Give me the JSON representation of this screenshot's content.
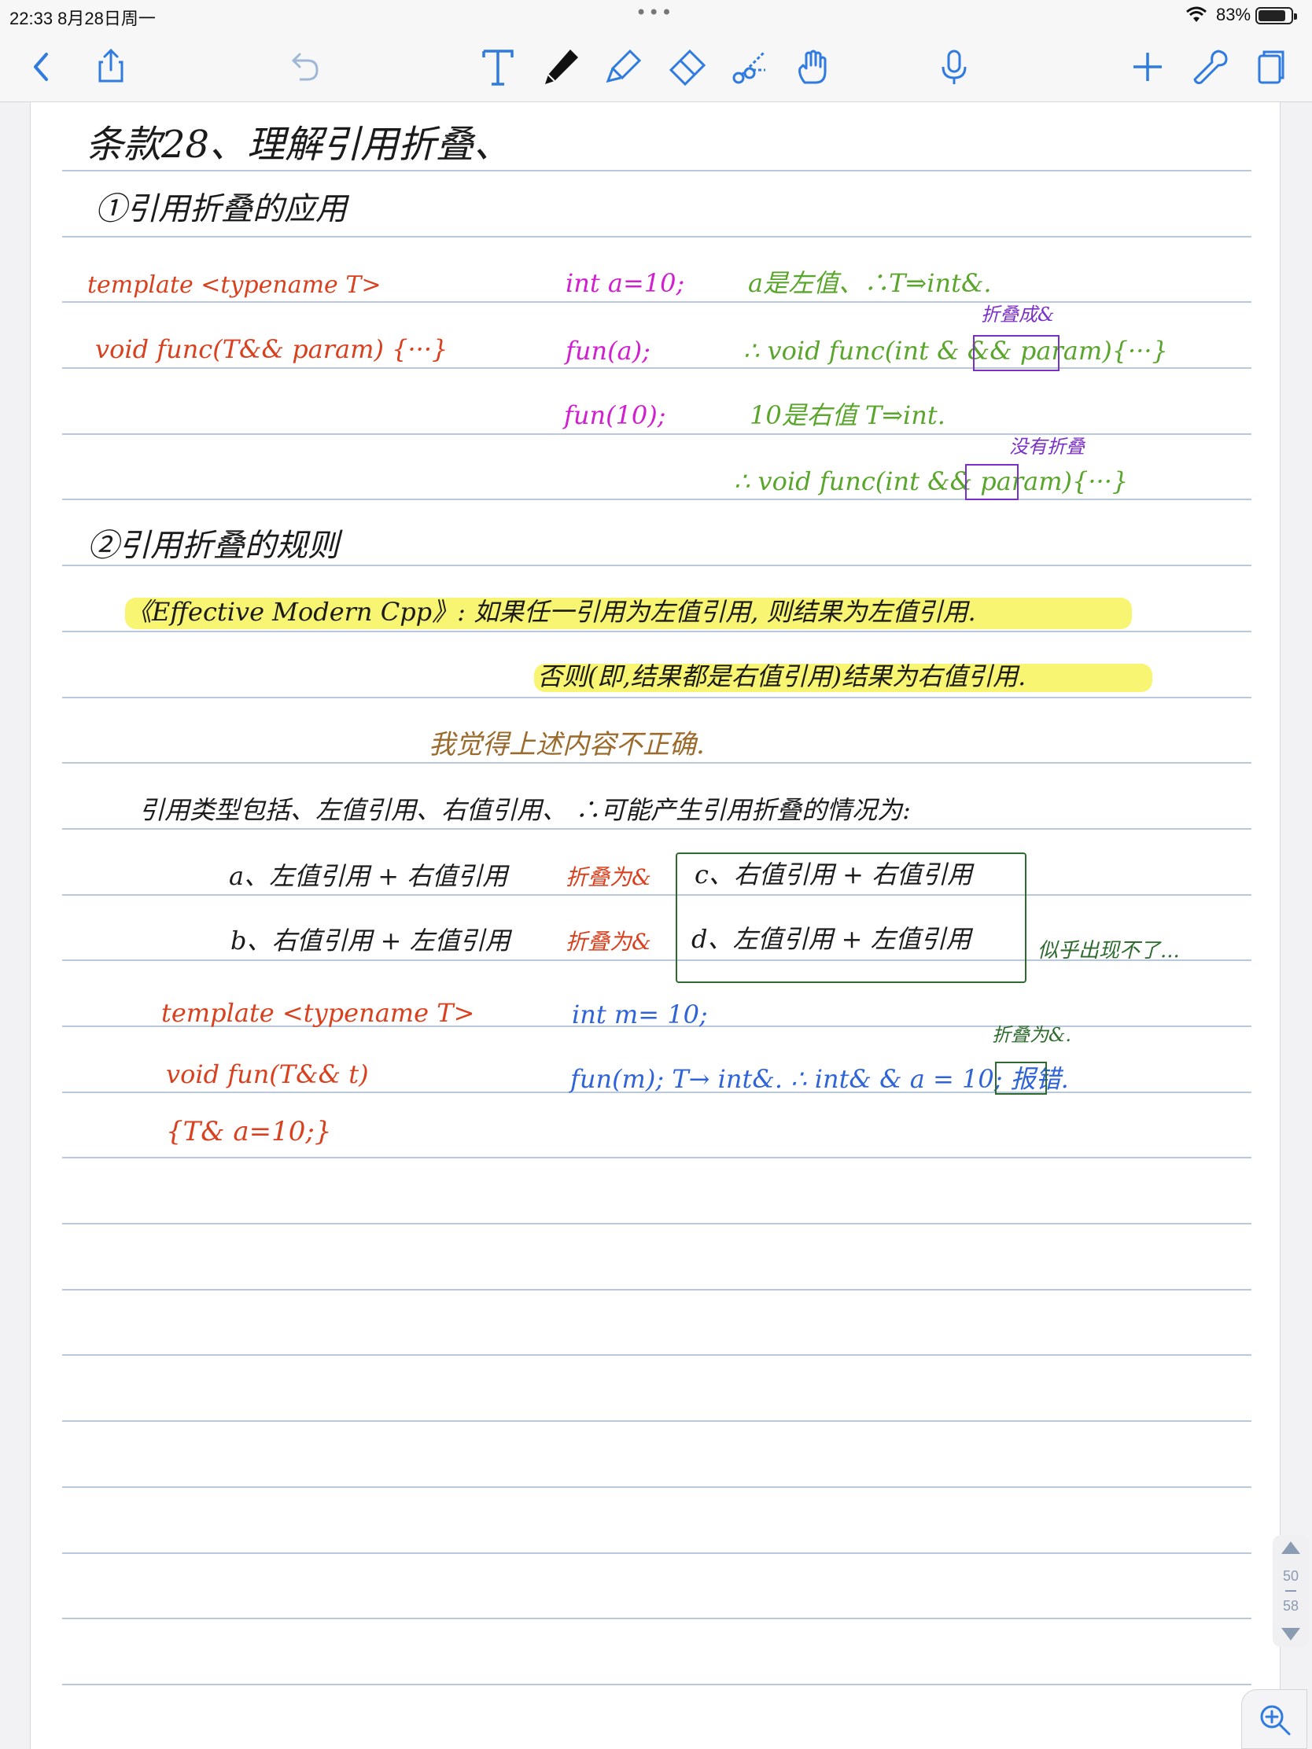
{
  "status_bar": {
    "time_date": "22:33   8月28日周一",
    "battery_percent": "83%",
    "dots": "•••"
  },
  "toolbar": {
    "icons": [
      "back-icon",
      "share-icon",
      "undo-icon",
      "text-tool-icon",
      "pen-icon",
      "highlighter-icon",
      "eraser-icon",
      "lasso-icon",
      "hand-icon",
      "microphone-icon",
      "add-page-icon",
      "settings-icon",
      "pages-icon"
    ]
  },
  "note": {
    "title": "条款28、理解引用折叠、",
    "section1": "①引用折叠的应用",
    "tpl1_line1": "template <typename T>",
    "tpl1_line2": "void func(T&& param) {···}",
    "call1_decl": "int a=10;",
    "call1_note": "a是左值、∴T⇒int&.",
    "collapse_label_1": "折叠成&",
    "call1_fun": "fun(a);",
    "call1_result": "∴ void func(int & && param){···}",
    "call2_fun": "fun(10);",
    "call2_note": "10是右值  T⇒int.",
    "collapse_label_2": "没有折叠",
    "call2_result": "∴ void func(int && param){···}",
    "section2": "②引用折叠的规则",
    "rule_line1": "《Effective Modern Cpp》: 如果任一引用为左值引用, 则结果为左值引用.",
    "rule_line2": "否则(即,结果都是右值引用)结果为右值引用.",
    "comment": "我觉得上述内容不正确.",
    "ref_types": "引用类型包括、左值引用、右值引用、  ∴可能产生引用折叠的情况为:",
    "case_a": "a、左值引用 + 右值引用",
    "case_a_tag": "折叠为&",
    "case_b": "b、右值引用 + 左值引用",
    "case_b_tag": "折叠为&",
    "case_c": "c、右值引用 + 右值引用",
    "case_d": "d、左值引用 + 左值引用",
    "case_cd_note": "似乎出现不了...",
    "tpl2_line1": "template <typename T>",
    "tpl2_line2": "void fun(T&& t)",
    "tpl2_line3": "{T& a=10;}",
    "ex2_decl": "int m= 10;",
    "ex2_label": "折叠为&.",
    "ex2_call": "fun(m);  T→ int&.    ∴ int& & a = 10; 报错."
  },
  "pager": {
    "current": "50",
    "total": "58"
  }
}
